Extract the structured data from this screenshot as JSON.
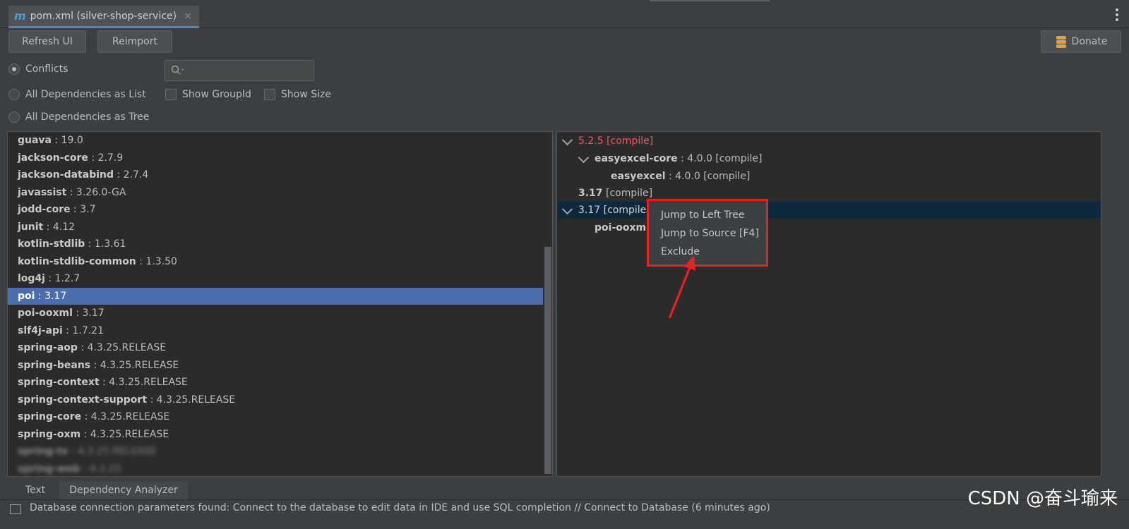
{
  "tab": {
    "icon": "m",
    "title": "pom.xml (silver-shop-service)",
    "close": "×"
  },
  "toolbar": {
    "refresh_label": "Refresh UI",
    "reimport_label": "Reimport",
    "donate_label": "Donate"
  },
  "options": {
    "conflicts_label": "Conflicts",
    "all_list_label": "All Dependencies as List",
    "all_tree_label": "All Dependencies as Tree",
    "show_groupid_label": "Show GroupId",
    "show_size_label": "Show Size",
    "search_placeholder": "",
    "selected_mode": "Conflicts"
  },
  "left_list": [
    {
      "name": "guava",
      "version": " : 19.0"
    },
    {
      "name": "jackson-core",
      "version": " : 2.7.9"
    },
    {
      "name": "jackson-databind",
      "version": " : 2.7.4"
    },
    {
      "name": "javassist",
      "version": " : 3.26.0-GA"
    },
    {
      "name": "jodd-core",
      "version": " : 3.7"
    },
    {
      "name": "junit",
      "version": " : 4.12"
    },
    {
      "name": "kotlin-stdlib",
      "version": " : 1.3.61"
    },
    {
      "name": "kotlin-stdlib-common",
      "version": " : 1.3.50"
    },
    {
      "name": "log4j",
      "version": " : 1.2.7"
    },
    {
      "name": "poi",
      "version": " : 3.17",
      "selected": true
    },
    {
      "name": "poi-ooxml",
      "version": " : 3.17"
    },
    {
      "name": "slf4j-api",
      "version": " : 1.7.21"
    },
    {
      "name": "spring-aop",
      "version": " : 4.3.25.RELEASE"
    },
    {
      "name": "spring-beans",
      "version": " : 4.3.25.RELEASE"
    },
    {
      "name": "spring-context",
      "version": " : 4.3.25.RELEASE"
    },
    {
      "name": "spring-context-support",
      "version": " : 4.3.25.RELEASE"
    },
    {
      "name": "spring-core",
      "version": " : 4.3.25.RELEASE"
    },
    {
      "name": "spring-oxm",
      "version": " : 4.3.25.RELEASE"
    },
    {
      "name": "spring-tx",
      "version": " : 4.3.25.RELEASE",
      "blurred": true
    },
    {
      "name": "spring-web",
      "version": " : 4.3.25",
      "blurred": true
    }
  ],
  "right_tree": {
    "n1": "5.2.5 [compile]",
    "n2_name": "easyexcel-core",
    "n2_ver": " : 4.0.0 [compile]",
    "n3_name": "easyexcel",
    "n3_ver": " : 4.0.0 [compile]",
    "n4_name": "3.17",
    "n4_ver": " [compile]",
    "n5_name": "3.17",
    "n5_ver": " [compile",
    "n6_name": "poi-ooxm"
  },
  "context_menu": {
    "item1": "Jump to Left Tree",
    "item2": "Jump to Source [F4]",
    "item3": "Exclude"
  },
  "bottom_tabs": {
    "text_label": "Text",
    "analyzer_label": "Dependency Analyzer"
  },
  "status": {
    "message": "Database connection parameters found: Connect to the database to edit data in IDE and use SQL completion // Connect to Database (6 minutes ago)"
  },
  "watermark": "CSDN @奋斗瑜来",
  "colors": {
    "accent": "#4a88c7",
    "selection": "#4b6eaf",
    "conflict": "#f75464",
    "highlight_box": "#e8231f"
  }
}
